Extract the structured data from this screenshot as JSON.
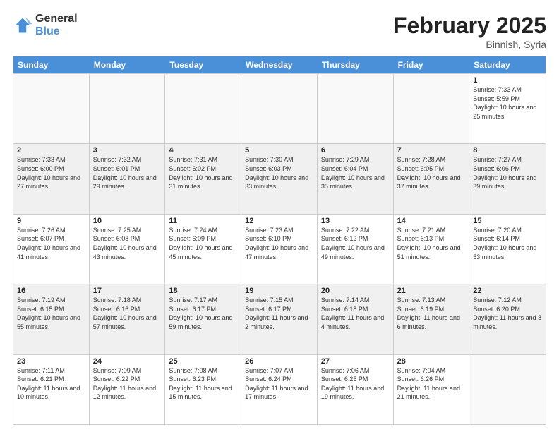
{
  "logo": {
    "general": "General",
    "blue": "Blue"
  },
  "title": "February 2025",
  "subtitle": "Binnish, Syria",
  "days": [
    "Sunday",
    "Monday",
    "Tuesday",
    "Wednesday",
    "Thursday",
    "Friday",
    "Saturday"
  ],
  "rows": [
    [
      {
        "day": "",
        "info": ""
      },
      {
        "day": "",
        "info": ""
      },
      {
        "day": "",
        "info": ""
      },
      {
        "day": "",
        "info": ""
      },
      {
        "day": "",
        "info": ""
      },
      {
        "day": "",
        "info": ""
      },
      {
        "day": "1",
        "info": "Sunrise: 7:33 AM\nSunset: 5:59 PM\nDaylight: 10 hours and 25 minutes."
      }
    ],
    [
      {
        "day": "2",
        "info": "Sunrise: 7:33 AM\nSunset: 6:00 PM\nDaylight: 10 hours and 27 minutes."
      },
      {
        "day": "3",
        "info": "Sunrise: 7:32 AM\nSunset: 6:01 PM\nDaylight: 10 hours and 29 minutes."
      },
      {
        "day": "4",
        "info": "Sunrise: 7:31 AM\nSunset: 6:02 PM\nDaylight: 10 hours and 31 minutes."
      },
      {
        "day": "5",
        "info": "Sunrise: 7:30 AM\nSunset: 6:03 PM\nDaylight: 10 hours and 33 minutes."
      },
      {
        "day": "6",
        "info": "Sunrise: 7:29 AM\nSunset: 6:04 PM\nDaylight: 10 hours and 35 minutes."
      },
      {
        "day": "7",
        "info": "Sunrise: 7:28 AM\nSunset: 6:05 PM\nDaylight: 10 hours and 37 minutes."
      },
      {
        "day": "8",
        "info": "Sunrise: 7:27 AM\nSunset: 6:06 PM\nDaylight: 10 hours and 39 minutes."
      }
    ],
    [
      {
        "day": "9",
        "info": "Sunrise: 7:26 AM\nSunset: 6:07 PM\nDaylight: 10 hours and 41 minutes."
      },
      {
        "day": "10",
        "info": "Sunrise: 7:25 AM\nSunset: 6:08 PM\nDaylight: 10 hours and 43 minutes."
      },
      {
        "day": "11",
        "info": "Sunrise: 7:24 AM\nSunset: 6:09 PM\nDaylight: 10 hours and 45 minutes."
      },
      {
        "day": "12",
        "info": "Sunrise: 7:23 AM\nSunset: 6:10 PM\nDaylight: 10 hours and 47 minutes."
      },
      {
        "day": "13",
        "info": "Sunrise: 7:22 AM\nSunset: 6:12 PM\nDaylight: 10 hours and 49 minutes."
      },
      {
        "day": "14",
        "info": "Sunrise: 7:21 AM\nSunset: 6:13 PM\nDaylight: 10 hours and 51 minutes."
      },
      {
        "day": "15",
        "info": "Sunrise: 7:20 AM\nSunset: 6:14 PM\nDaylight: 10 hours and 53 minutes."
      }
    ],
    [
      {
        "day": "16",
        "info": "Sunrise: 7:19 AM\nSunset: 6:15 PM\nDaylight: 10 hours and 55 minutes."
      },
      {
        "day": "17",
        "info": "Sunrise: 7:18 AM\nSunset: 6:16 PM\nDaylight: 10 hours and 57 minutes."
      },
      {
        "day": "18",
        "info": "Sunrise: 7:17 AM\nSunset: 6:17 PM\nDaylight: 10 hours and 59 minutes."
      },
      {
        "day": "19",
        "info": "Sunrise: 7:15 AM\nSunset: 6:17 PM\nDaylight: 11 hours and 2 minutes."
      },
      {
        "day": "20",
        "info": "Sunrise: 7:14 AM\nSunset: 6:18 PM\nDaylight: 11 hours and 4 minutes."
      },
      {
        "day": "21",
        "info": "Sunrise: 7:13 AM\nSunset: 6:19 PM\nDaylight: 11 hours and 6 minutes."
      },
      {
        "day": "22",
        "info": "Sunrise: 7:12 AM\nSunset: 6:20 PM\nDaylight: 11 hours and 8 minutes."
      }
    ],
    [
      {
        "day": "23",
        "info": "Sunrise: 7:11 AM\nSunset: 6:21 PM\nDaylight: 11 hours and 10 minutes."
      },
      {
        "day": "24",
        "info": "Sunrise: 7:09 AM\nSunset: 6:22 PM\nDaylight: 11 hours and 12 minutes."
      },
      {
        "day": "25",
        "info": "Sunrise: 7:08 AM\nSunset: 6:23 PM\nDaylight: 11 hours and 15 minutes."
      },
      {
        "day": "26",
        "info": "Sunrise: 7:07 AM\nSunset: 6:24 PM\nDaylight: 11 hours and 17 minutes."
      },
      {
        "day": "27",
        "info": "Sunrise: 7:06 AM\nSunset: 6:25 PM\nDaylight: 11 hours and 19 minutes."
      },
      {
        "day": "28",
        "info": "Sunrise: 7:04 AM\nSunset: 6:26 PM\nDaylight: 11 hours and 21 minutes."
      },
      {
        "day": "",
        "info": ""
      }
    ]
  ]
}
